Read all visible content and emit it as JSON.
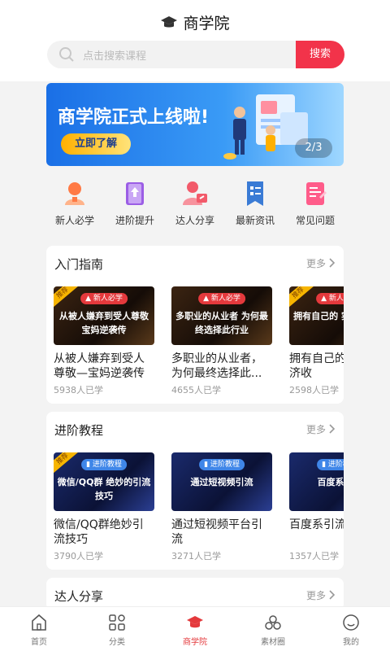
{
  "header": {
    "title": "商学院",
    "search_placeholder": "点击搜索课程",
    "search_button": "搜索"
  },
  "banner": {
    "title": "商学院正式上线啦!",
    "button": "立即了解",
    "page_current": "2",
    "page_total": "3",
    "page_sep": "/"
  },
  "categories": [
    {
      "label": "新人必学",
      "icon": "newbie-icon",
      "color": "#ff7a45"
    },
    {
      "label": "进阶提升",
      "icon": "book-icon",
      "color": "#9b5de5"
    },
    {
      "label": "达人分享",
      "icon": "share-icon",
      "color": "#f25a6a"
    },
    {
      "label": "最新资讯",
      "icon": "news-icon",
      "color": "#3a7bd5"
    },
    {
      "label": "常见问题",
      "icon": "question-icon",
      "color": "#ff5c8a"
    }
  ],
  "sections": [
    {
      "title": "入门指南",
      "more": "更多",
      "items": [
        {
          "tag": "新人必学",
          "thumb_text": "从被人嫌弃到受人尊敬 宝妈逆袭传",
          "name": "从被人嫌弃到受人尊敬—宝妈逆袭传",
          "count": "5938人已学",
          "ribbon": "推荐"
        },
        {
          "tag": "新人必学",
          "thumb_text": "多职业的从业者 为何最终选择此行业",
          "name": "多职业的从业者，为何最终选择此...",
          "count": "4655人已学",
          "ribbon": ""
        },
        {
          "tag": "新人必学",
          "thumb_text": "拥有自己的 实现经济收",
          "name": "拥有自己的 实现经济收",
          "count": "2598人已学",
          "ribbon": "推荐"
        }
      ]
    },
    {
      "title": "进阶教程",
      "more": "更多",
      "items": [
        {
          "tag": "进阶教程",
          "thumb_text": "微信/QQ群 绝妙的引流技巧",
          "name": "微信/QQ群绝妙引流技巧",
          "count": "3790人已学",
          "ribbon": "推荐"
        },
        {
          "tag": "进阶教程",
          "thumb_text": "通过短视频引流",
          "name": "通过短视频平台引流",
          "count": "3271人已学",
          "ribbon": ""
        },
        {
          "tag": "进阶教程",
          "thumb_text": "百度系引流",
          "name": "百度系引流享",
          "count": "1357人已学",
          "ribbon": ""
        }
      ]
    },
    {
      "title": "达人分享",
      "more": "更多",
      "items": []
    }
  ],
  "tabs": [
    {
      "label": "首页",
      "icon": "home-icon"
    },
    {
      "label": "分类",
      "icon": "grid-icon"
    },
    {
      "label": "商学院",
      "icon": "graduation-cap-icon"
    },
    {
      "label": "素材圈",
      "icon": "circle-icon"
    },
    {
      "label": "我的",
      "icon": "profile-icon"
    }
  ],
  "active_tab": 2,
  "colors": {
    "accent": "#e4393c",
    "search_button": "#f2334a"
  }
}
